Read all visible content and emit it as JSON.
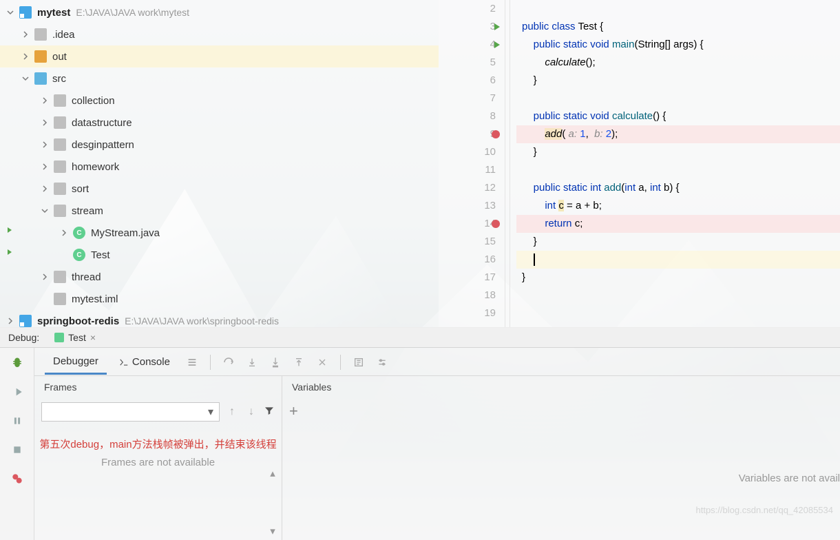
{
  "tree": {
    "root": {
      "name": "mytest",
      "path": "E:\\JAVA\\JAVA work\\mytest"
    },
    "idea": ".idea",
    "out": "out",
    "src": "src",
    "collection": "collection",
    "datastructure": "datastructure",
    "desginpattern": "desginpattern",
    "homework": "homework",
    "sort": "sort",
    "stream": "stream",
    "mystream": "MyStream.java",
    "test": "Test",
    "thread": "thread",
    "iml": "mytest.iml",
    "redis": {
      "name": "springboot-redis",
      "path": "E:\\JAVA\\JAVA work\\springboot-redis"
    }
  },
  "editor": {
    "lines": {
      "2": "2",
      "3": "3",
      "4": "4",
      "5": "5",
      "6": "6",
      "7": "7",
      "8": "8",
      "9": "9",
      "10": "10",
      "11": "11",
      "12": "12",
      "13": "13",
      "14": "14",
      "15": "15",
      "16": "16",
      "17": "17",
      "18": "18",
      "19": "19"
    },
    "code": {
      "l3": {
        "public": "public",
        "class": "class",
        "Test": "Test",
        "brace": " {"
      },
      "l4": {
        "public": "public",
        "static": "static",
        "void": "void",
        "main": "main",
        "params": "(String[] args) {"
      },
      "l5": {
        "call": "calculate",
        "rest": "();"
      },
      "l6": "}",
      "l8": {
        "public": "public",
        "static": "static",
        "void": "void",
        "name": "calculate",
        "rest": "() {"
      },
      "l9": {
        "call": "add",
        "open": "( ",
        "p1": "a: ",
        "v1": "1",
        "comma": ",  ",
        "p2": "b: ",
        "v2": "2",
        "close": ");"
      },
      "l10": "}",
      "l12": {
        "public": "public",
        "static": "static",
        "int": "int",
        "name": "add",
        "params": "(",
        "intk": "int",
        "a": " a, ",
        "intk2": "int",
        "b": " b) {"
      },
      "l13": {
        "intk": "int",
        "rest": " c = a + b;",
        "var": "c"
      },
      "l14": {
        "ret": "return",
        "rest": " c;"
      },
      "l15": "}",
      "l17": "}"
    }
  },
  "debug": {
    "label": "Debug:",
    "tab": "Test",
    "debugger": "Debugger",
    "console": "Console",
    "frames": "Frames",
    "variables": "Variables",
    "red_msg": "第五次debug，main方法栈帧被弹出，并结束该线程",
    "frames_na": "Frames are not available",
    "vars_na": "Variables are not avail"
  },
  "watermark": "https://blog.csdn.net/qq_42085534"
}
